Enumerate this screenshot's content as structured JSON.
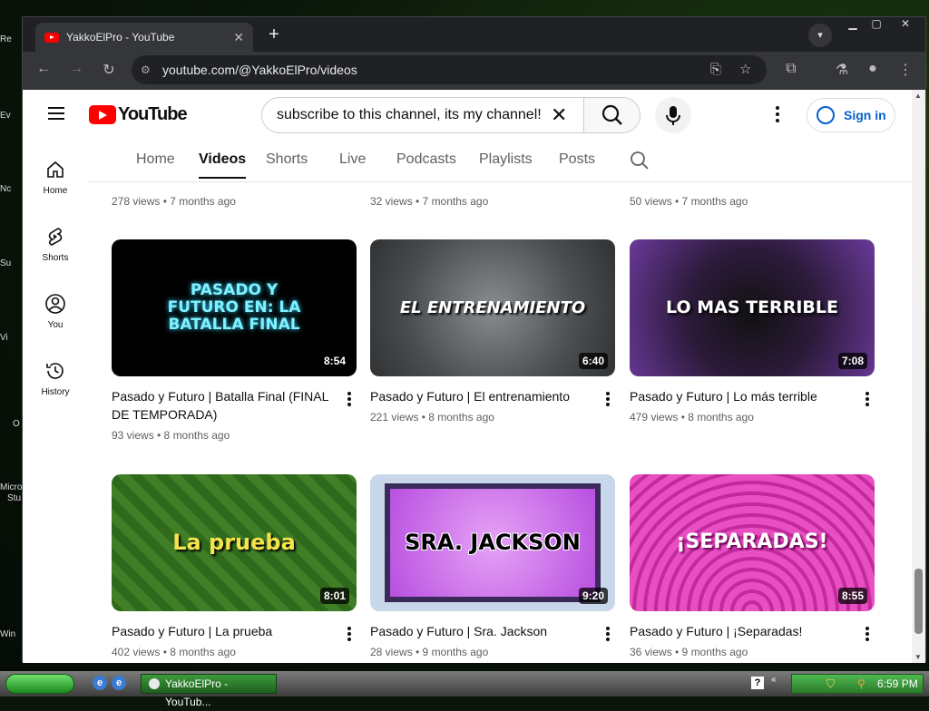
{
  "desktop": {
    "labels": [
      "Re",
      "Ev",
      "Nc",
      "Su",
      "Vi",
      "O",
      "Micro",
      "Stu",
      "Win"
    ]
  },
  "browser": {
    "tab_title": "YakkoElPro - YouTube",
    "url": "youtube.com/@YakkoElPro/videos"
  },
  "youtube": {
    "logo_text": "YouTube",
    "search_value": "subscribe to this channel, its my channel!",
    "sign_in": "Sign in",
    "sidebar": [
      {
        "label": "Home"
      },
      {
        "label": "Shorts"
      },
      {
        "label": "You"
      },
      {
        "label": "History"
      }
    ],
    "channel_tabs": [
      "Home",
      "Videos",
      "Shorts",
      "Live",
      "Podcasts",
      "Playlists",
      "Posts"
    ],
    "active_tab": "Videos",
    "partial_row": [
      {
        "meta": "278 views • 7 months ago"
      },
      {
        "meta": "32 views • 7 months ago"
      },
      {
        "meta": "50 views • 7 months ago"
      }
    ],
    "videos": [
      {
        "thumb_text": "PASADO Y FUTURO EN: LA BATALLA FINAL",
        "duration": "8:54",
        "title": "Pasado y Futuro | Batalla Final (FINAL DE TEMPORADA)",
        "meta": "93 views • 8 months ago"
      },
      {
        "thumb_text": "EL ENTRENAMIENTO",
        "duration": "6:40",
        "title": "Pasado y Futuro | El entrenamiento",
        "meta": "221 views • 8 months ago"
      },
      {
        "thumb_text": "LO MAS TERRIBLE",
        "duration": "7:08",
        "title": "Pasado y Futuro | Lo más terrible",
        "meta": "479 views • 8 months ago"
      },
      {
        "thumb_text": "La prueba",
        "duration": "8:01",
        "title": "Pasado y Futuro | La prueba",
        "meta": "402 views • 8 months ago"
      },
      {
        "thumb_text": "SRA. JACKSON",
        "duration": "9:20",
        "title": "Pasado y Futuro | Sra. Jackson",
        "meta": "28 views • 9 months ago"
      },
      {
        "thumb_text": "¡SEPARADAS!",
        "duration": "8:55",
        "title": "Pasado y Futuro | ¡Separadas!",
        "meta": "36 views • 9 months ago"
      }
    ]
  },
  "taskbar": {
    "app_label": "YakkoElPro - YouTub...",
    "clock": "6:59 PM"
  }
}
